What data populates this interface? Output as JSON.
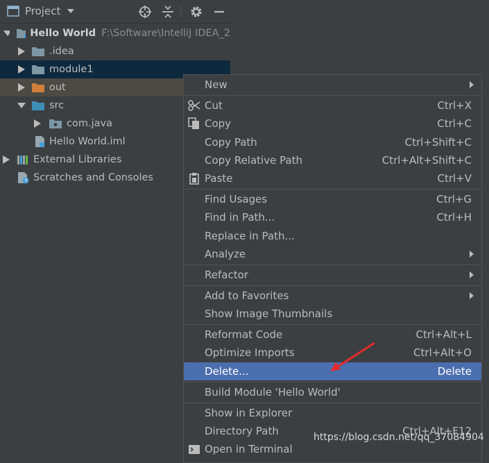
{
  "header": {
    "title": "Project"
  },
  "tree": {
    "root_label": "Hello World",
    "root_path": "F:\\Software\\IntelliJ IDEA_2",
    "items": [
      "Hello World",
      ".idea",
      "module1",
      "out",
      "src",
      "com.java",
      "Hello World.iml",
      "External Libraries",
      "Scratches and Consoles"
    ]
  },
  "menu": {
    "new": "New",
    "cut": "Cut",
    "cut_sc": "Ctrl+X",
    "copy": "Copy",
    "copy_sc": "Ctrl+C",
    "copy_path": "Copy Path",
    "copy_path_sc": "Ctrl+Shift+C",
    "copy_rel": "Copy Relative Path",
    "copy_rel_sc": "Ctrl+Alt+Shift+C",
    "paste": "Paste",
    "paste_sc": "Ctrl+V",
    "find_usages": "Find Usages",
    "find_usages_sc": "Ctrl+G",
    "find_in_path": "Find in Path...",
    "find_in_path_sc": "Ctrl+H",
    "replace_in_path": "Replace in Path...",
    "analyze": "Analyze",
    "refactor": "Refactor",
    "add_fav": "Add to Favorites",
    "show_thumbs": "Show Image Thumbnails",
    "reformat": "Reformat Code",
    "reformat_sc": "Ctrl+Alt+L",
    "optimize": "Optimize Imports",
    "optimize_sc": "Ctrl+Alt+O",
    "delete": "Delete...",
    "delete_sc": "Delete",
    "build": "Build Module 'Hello World'",
    "show_explorer": "Show in Explorer",
    "dir_path": "Directory Path",
    "dir_path_sc": "Ctrl+Alt+F12",
    "open_terminal": "Open in Terminal"
  },
  "watermark": "https://blog.csdn.net/qq_37084904",
  "colors": {
    "panel_bg": "#3c3f41",
    "selected_row": "#0d293e",
    "excluded_row": "#4b4a44",
    "menu_highlight": "#4b6eaf",
    "folder_blue": "#7d97a5",
    "folder_orange": "#d0803a",
    "source_folder": "#3d8fb8",
    "annotation_arrow": "#e32b2b"
  }
}
